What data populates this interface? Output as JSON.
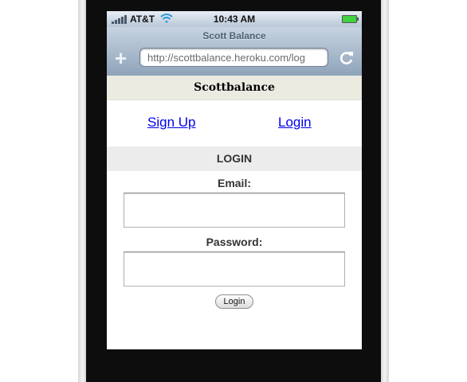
{
  "status_bar": {
    "carrier": "AT&T",
    "time": "10:43 AM",
    "signal_bars": 5,
    "battery_level": 1.0,
    "icons": [
      "signal-icon",
      "wifi-icon",
      "battery-icon"
    ]
  },
  "browser": {
    "page_title": "Scott Balance",
    "url": "http://scottbalance.heroku.com/log",
    "add_bookmark_label": "+",
    "reload_icon": "reload-icon"
  },
  "site": {
    "header_title": "Scottbalance",
    "nav": {
      "signup_label": "Sign Up",
      "login_label": "Login"
    }
  },
  "login_form": {
    "section_title": "LOGIN",
    "email_label": "Email:",
    "email_value": "",
    "password_label": "Password:",
    "password_value": "",
    "submit_label": "Login"
  },
  "colors": {
    "link": "#0000ee",
    "header_bg": "#ebebe2",
    "section_bg": "#ececec",
    "phone_frame": "#0d0d0d"
  }
}
